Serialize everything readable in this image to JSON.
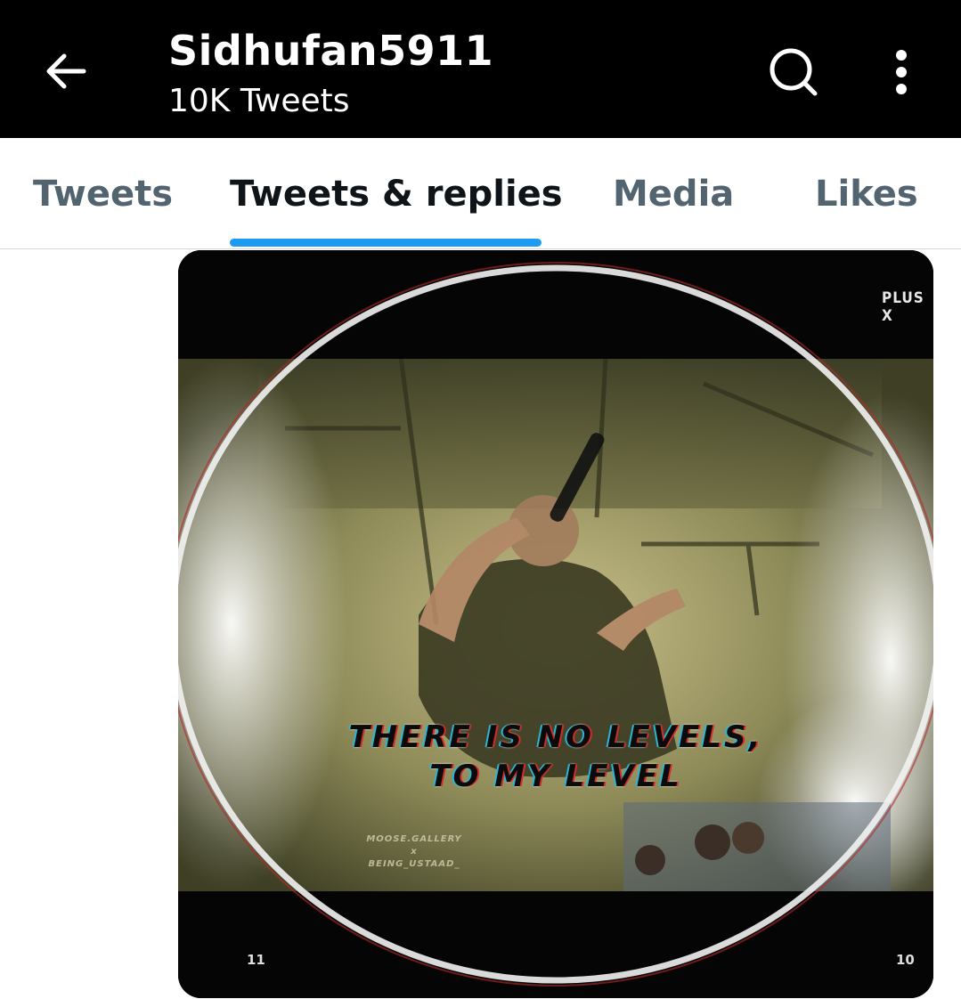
{
  "header": {
    "title": "Sidhufan5911",
    "subtitle": "10K Tweets"
  },
  "tabs": [
    {
      "label": "Tweets",
      "active": false
    },
    {
      "label": "Tweets & replies",
      "active": true
    },
    {
      "label": "Media",
      "active": false
    },
    {
      "label": "Likes",
      "active": false
    }
  ],
  "media": {
    "watermark": "PLUS X",
    "quote_line1": "THERE IS NO LEVELS,",
    "quote_line2": "TO MY LEVEL",
    "credit_line1": "MOOSE.GALLERY",
    "credit_line2": "x",
    "credit_line3": "BEING_USTAAD_",
    "frame_left": "11",
    "frame_right": "10"
  },
  "colors": {
    "accent": "#1d9bf0",
    "tab_inactive": "#536471",
    "tab_active": "#0f1419",
    "topbar": "#000000"
  },
  "icons": {
    "back": "arrow-left-icon",
    "search": "search-icon",
    "more": "more-vertical-icon"
  }
}
